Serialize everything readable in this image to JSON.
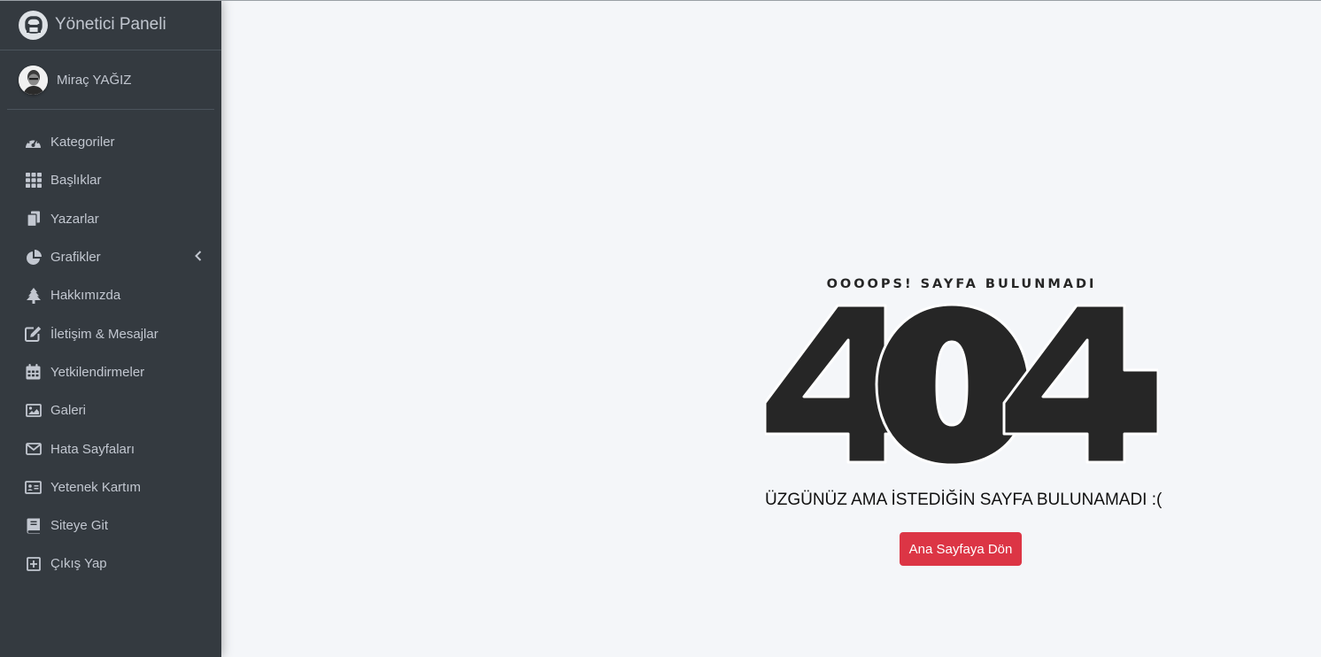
{
  "brand": {
    "title": "Yönetici Paneli",
    "logo_icon": "logo-a-icon"
  },
  "user": {
    "name": "Miraç YAĞIZ"
  },
  "sidebar": {
    "items": [
      {
        "label": "Kategoriler",
        "icon": "tachometer-icon"
      },
      {
        "label": "Başlıklar",
        "icon": "grid-icon"
      },
      {
        "label": "Yazarlar",
        "icon": "copy-icon"
      },
      {
        "label": "Grafikler",
        "icon": "pie-chart-icon",
        "has_submenu": true
      },
      {
        "label": "Hakkımızda",
        "icon": "tree-icon"
      },
      {
        "label": "İletişim & Mesajlar",
        "icon": "edit-icon"
      },
      {
        "label": "Yetkilendirmeler",
        "icon": "calendar-icon"
      },
      {
        "label": "Galeri",
        "icon": "image-icon"
      },
      {
        "label": "Hata Sayfaları",
        "icon": "envelope-icon"
      },
      {
        "label": "Yetenek Kartım",
        "icon": "id-card-icon"
      },
      {
        "label": "Siteye Git",
        "icon": "book-icon"
      },
      {
        "label": "Çıkış Yap",
        "icon": "plus-square-icon"
      }
    ]
  },
  "notfound": {
    "heading": "OOOOPS! SAYFA BULUNMADI",
    "code": "404",
    "message": "ÜZGÜNÜZ AMA İSTEDİĞİN SAYFA BULUNAMADI :(",
    "button_label": "Ana Sayfaya Dön",
    "button_color": "#dc3545"
  },
  "colors": {
    "sidebar_bg": "#343a40",
    "page_bg": "#f4f6f9",
    "text_light": "#c2c7d0"
  }
}
